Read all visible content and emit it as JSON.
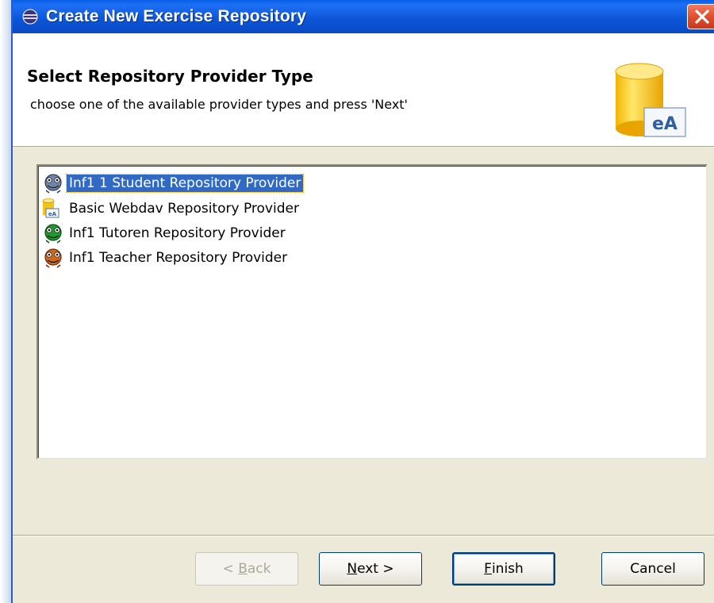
{
  "window": {
    "title": "Create New Exercise Repository",
    "close_glyph": "✕"
  },
  "banner": {
    "title": "Select Repository Provider Type",
    "description": "choose one of the available provider types and press 'Next'",
    "logo_text": "eA"
  },
  "providers": [
    {
      "label": "Inf1 1 Student Repository Provider",
      "icon": "student-monster-icon",
      "selected": true
    },
    {
      "label": "Basic Webdav Repository Provider",
      "icon": "webdav-database-icon",
      "selected": false
    },
    {
      "label": "Inf1 Tutoren Repository Provider",
      "icon": "tutor-monster-icon",
      "selected": false
    },
    {
      "label": "Inf1 Teacher Repository Provider",
      "icon": "teacher-monster-icon",
      "selected": false
    }
  ],
  "buttons": {
    "back": {
      "pre": "< ",
      "mnemonic": "B",
      "post": "ack",
      "enabled": false
    },
    "next": {
      "pre": "",
      "mnemonic": "N",
      "post": "ext >",
      "enabled": true
    },
    "finish": {
      "pre": "",
      "mnemonic": "F",
      "post": "inish",
      "enabled": true
    },
    "cancel": {
      "label": "Cancel",
      "enabled": true
    }
  },
  "colors": {
    "titlebar": "#0a55d6",
    "selection": "#316ac5",
    "dialog_bg": "#ece9d8"
  }
}
